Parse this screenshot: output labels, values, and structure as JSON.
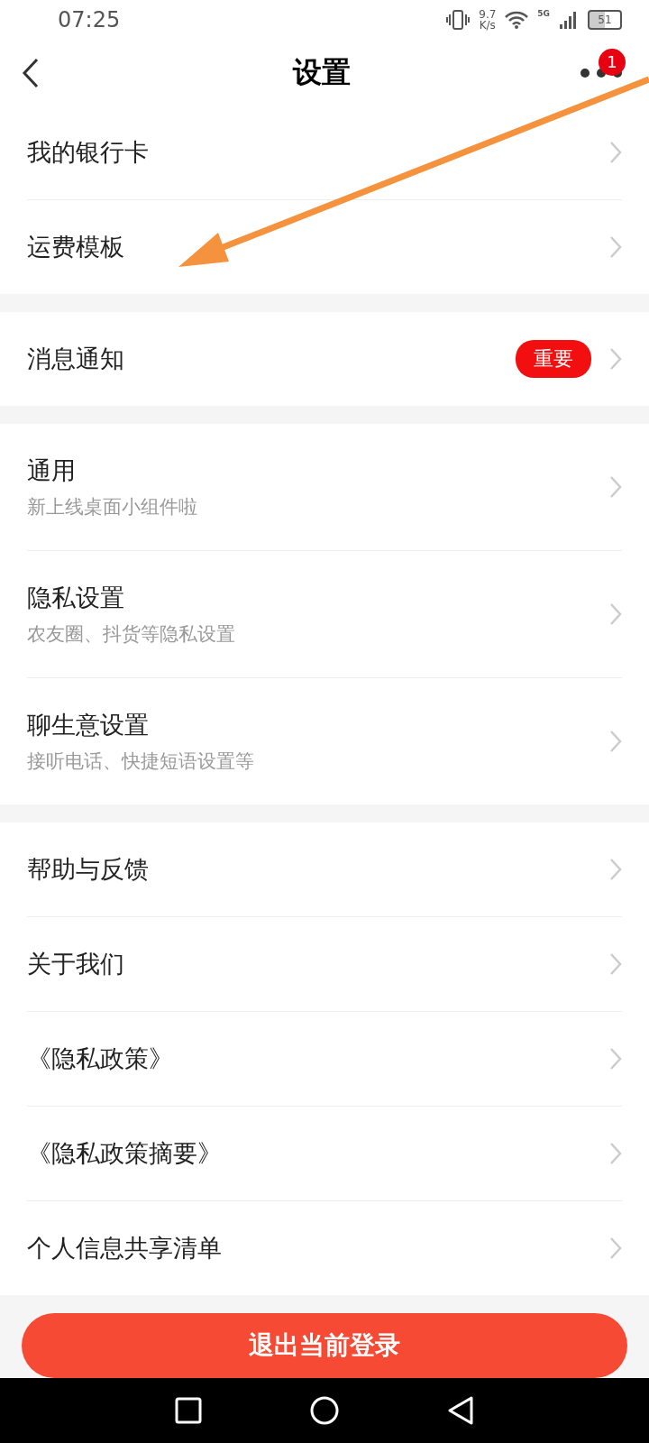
{
  "status_bar": {
    "time": "07:25",
    "speed_value": "9.7",
    "speed_unit": "K/s",
    "network": "5G",
    "battery": "51"
  },
  "header": {
    "title": "设置",
    "badge": "1"
  },
  "groups": [
    {
      "items": [
        {
          "title": "我的银行卡"
        },
        {
          "title": "运费模板"
        }
      ]
    },
    {
      "items": [
        {
          "title": "消息通知",
          "tag": "重要"
        }
      ]
    },
    {
      "items": [
        {
          "title": "通用",
          "subtitle": "新上线桌面小组件啦"
        },
        {
          "title": "隐私设置",
          "subtitle": "农友圈、抖货等隐私设置"
        },
        {
          "title": "聊生意设置",
          "subtitle": "接听电话、快捷短语设置等"
        }
      ]
    },
    {
      "items": [
        {
          "title": "帮助与反馈"
        },
        {
          "title": "关于我们"
        },
        {
          "title": "《隐私政策》"
        },
        {
          "title": "《隐私政策摘要》"
        },
        {
          "title": "个人信息共享清单"
        }
      ]
    }
  ],
  "logout_button": "退出当前登录"
}
